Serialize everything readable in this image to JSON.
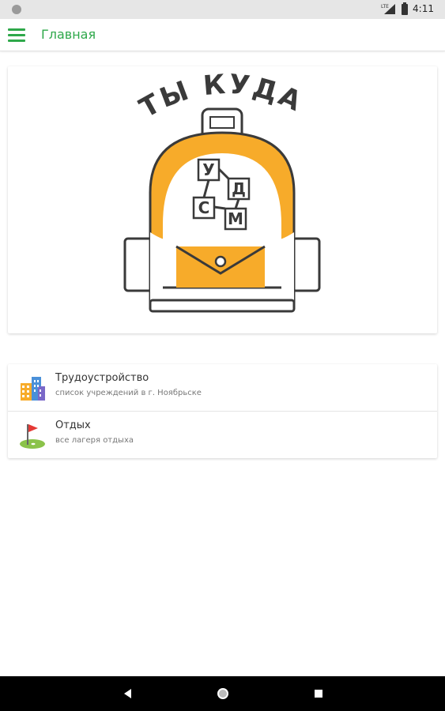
{
  "status_bar": {
    "time": "4:11",
    "network_label": "LTE"
  },
  "app_bar": {
    "title": "Главная",
    "menu_icon": "hamburger-icon"
  },
  "hero": {
    "logo_text": "ТЫ КУДА?",
    "cube_letters": [
      "У",
      "Д",
      "С",
      "М"
    ],
    "colors": {
      "accent": "#f7ab2a",
      "ink": "#3a3a3a"
    }
  },
  "menu_items": [
    {
      "title": "Трудоустройство",
      "subtitle": "список учреждений в г. Ноябрьске",
      "icon": "buildings-icon"
    },
    {
      "title": "Отдых",
      "subtitle": "все лагеря отдыха",
      "icon": "golf-flag-icon"
    }
  ],
  "colors": {
    "primary": "#2ea84a",
    "statusbar": "#e6e6e6",
    "navbar": "#000000"
  }
}
